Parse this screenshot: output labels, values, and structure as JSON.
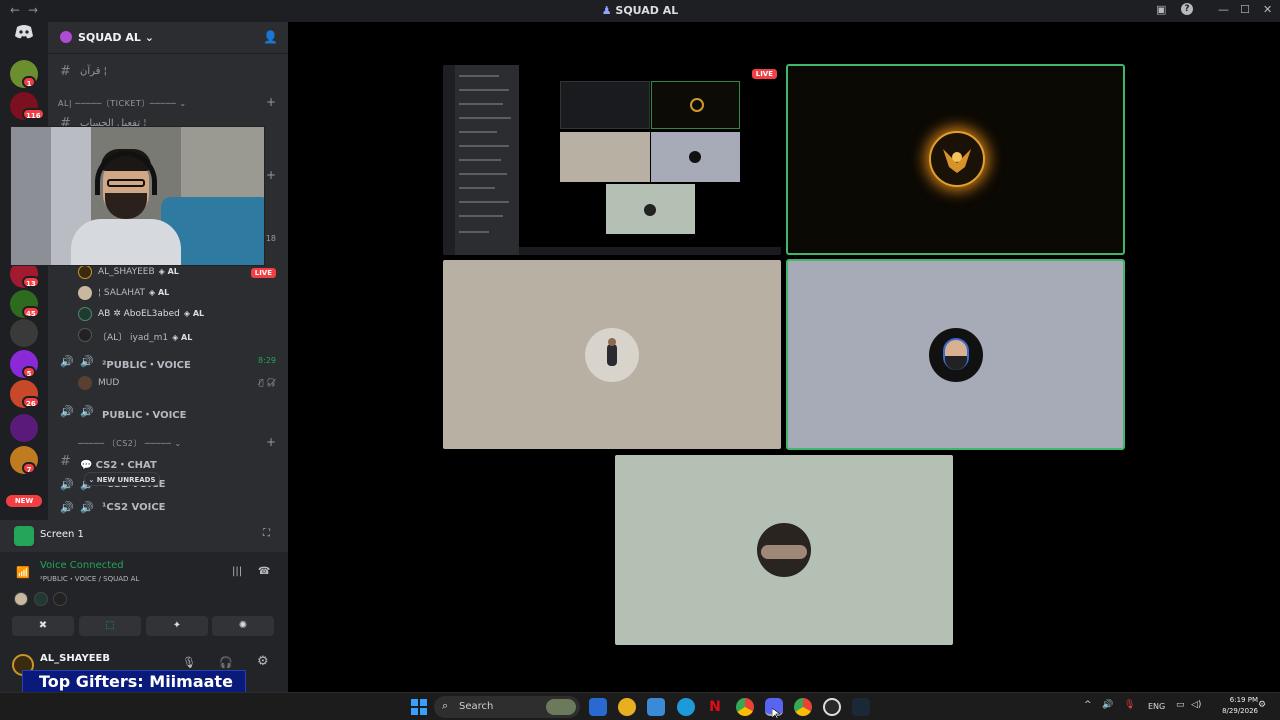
{
  "window": {
    "title": "SQUAD AL",
    "back": "←",
    "forward": "→",
    "inbox_icon": "▣",
    "help_icon": "?",
    "minimize": "—",
    "maximize": "☐",
    "close": "✕"
  },
  "rail": {
    "home_icon": "discord-icon",
    "servers": [
      {
        "badge": "1",
        "color": "#6b8f2e"
      },
      {
        "badge": "116",
        "color": "#7a1020"
      },
      {
        "badge": "13",
        "color": "#a11a30"
      },
      {
        "badge": "45",
        "color": "#2f6b1f"
      },
      {
        "badge": "",
        "color": "#3a3a3a"
      },
      {
        "badge": "5",
        "color": "#8a2ad6"
      },
      {
        "badge": "26",
        "color": "#c8482a"
      },
      {
        "badge": "",
        "color": "#5a1a7a"
      },
      {
        "badge": "7",
        "color": "#c07a20"
      }
    ],
    "new_label": "NEW"
  },
  "sidebar": {
    "server_name": "SQUAD AL",
    "chevron": "⌄",
    "invite_icon": "person-add-icon",
    "top_channel": "قرآن ¦",
    "ticket_category": "AL| ─────〔TICKET〕───── ⌄",
    "hidden_channel": "تفعيل الحساب ¦",
    "add": "+",
    "hash": "#",
    "speaker": "🔊",
    "user_limit": "18",
    "live_label": "LIVE",
    "users": [
      {
        "name": "AL_SHAYEEB",
        "tag": "◈ AL",
        "color": "#c9962a"
      },
      {
        "name": "¦ SALAHAT",
        "tag": "◈ AL",
        "color": "#c9b8a0"
      },
      {
        "name": "AB ✲ AboEL3abed",
        "tag": "◈ AL",
        "color": "#4a8a6a"
      },
      {
        "name": "〔AL〕 iyad_m1",
        "tag": "◈ AL",
        "color": "#222222"
      }
    ],
    "public_voice_2": "²PUBLIC・VOICE",
    "public_voice_2_time": "8:29",
    "mud_user": "MUD",
    "mud_icons": "🎙̸ 🎧̸",
    "public_voice": "PUBLIC・VOICE",
    "cs2_category": "───── 〔CS2〕 ───── ⌄",
    "cs2_chat": "CS2・CHAT",
    "cs2_voice": "²CS2 VOICE",
    "cs2_voice_1": "¹CS2 VOICE",
    "new_unreads": "⌄ NEW UNREADS"
  },
  "bottom": {
    "screen_label": "Screen 1",
    "voice_connected": "Voice Connected",
    "voice_channel": "²PUBLIC・VOICE / SQUAD AL",
    "voice_buttons": [
      "✖",
      "⬚",
      "✦",
      "✺"
    ],
    "username": "AL_SHAYEEB",
    "mic_icon": "🎙",
    "headphone_icon": "🎧",
    "settings_icon": "⚙",
    "top_gifters": "Top Gifters: Miimaate"
  },
  "stage": {
    "live_label": "LIVE"
  },
  "taskbar": {
    "search_label": "Search",
    "search_icon": "⌕",
    "language": "ENG",
    "time": "6:19 PM",
    "date": "8/29/2026",
    "tray_up": "^",
    "tray_vol": "🔊",
    "tray_mic": "🎙"
  },
  "colors": {
    "speaking_outline": "#3fb86a",
    "live_red": "#f23f43",
    "voice_green": "#23a55a"
  }
}
